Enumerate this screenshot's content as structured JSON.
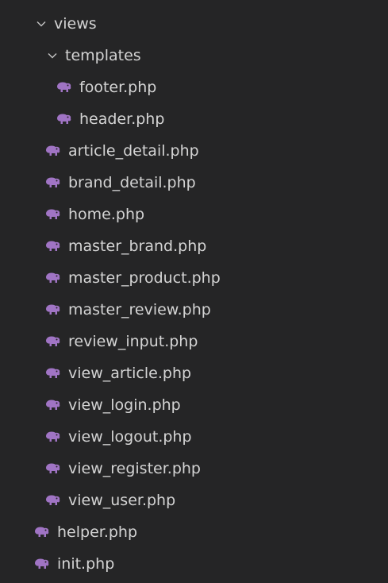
{
  "theme": {
    "background": "#252526",
    "text": "#d4d4d4",
    "php_icon_color": "#a074c4"
  },
  "tree": {
    "views_folder": {
      "label": "views",
      "icon": "chevron-down-icon"
    },
    "templates_folder": {
      "label": "templates",
      "icon": "chevron-down-icon"
    },
    "template_files": [
      {
        "label": "footer.php",
        "icon": "php-elephant-icon"
      },
      {
        "label": "header.php",
        "icon": "php-elephant-icon"
      }
    ],
    "view_files": [
      {
        "label": "article_detail.php",
        "icon": "php-elephant-icon"
      },
      {
        "label": "brand_detail.php",
        "icon": "php-elephant-icon"
      },
      {
        "label": "home.php",
        "icon": "php-elephant-icon"
      },
      {
        "label": "master_brand.php",
        "icon": "php-elephant-icon"
      },
      {
        "label": "master_product.php",
        "icon": "php-elephant-icon"
      },
      {
        "label": "master_review.php",
        "icon": "php-elephant-icon"
      },
      {
        "label": "review_input.php",
        "icon": "php-elephant-icon"
      },
      {
        "label": "view_article.php",
        "icon": "php-elephant-icon"
      },
      {
        "label": "view_login.php",
        "icon": "php-elephant-icon"
      },
      {
        "label": "view_logout.php",
        "icon": "php-elephant-icon"
      },
      {
        "label": "view_register.php",
        "icon": "php-elephant-icon"
      },
      {
        "label": "view_user.php",
        "icon": "php-elephant-icon"
      }
    ],
    "root_files": [
      {
        "label": "helper.php",
        "icon": "php-elephant-icon"
      },
      {
        "label": "init.php",
        "icon": "php-elephant-icon"
      }
    ]
  }
}
